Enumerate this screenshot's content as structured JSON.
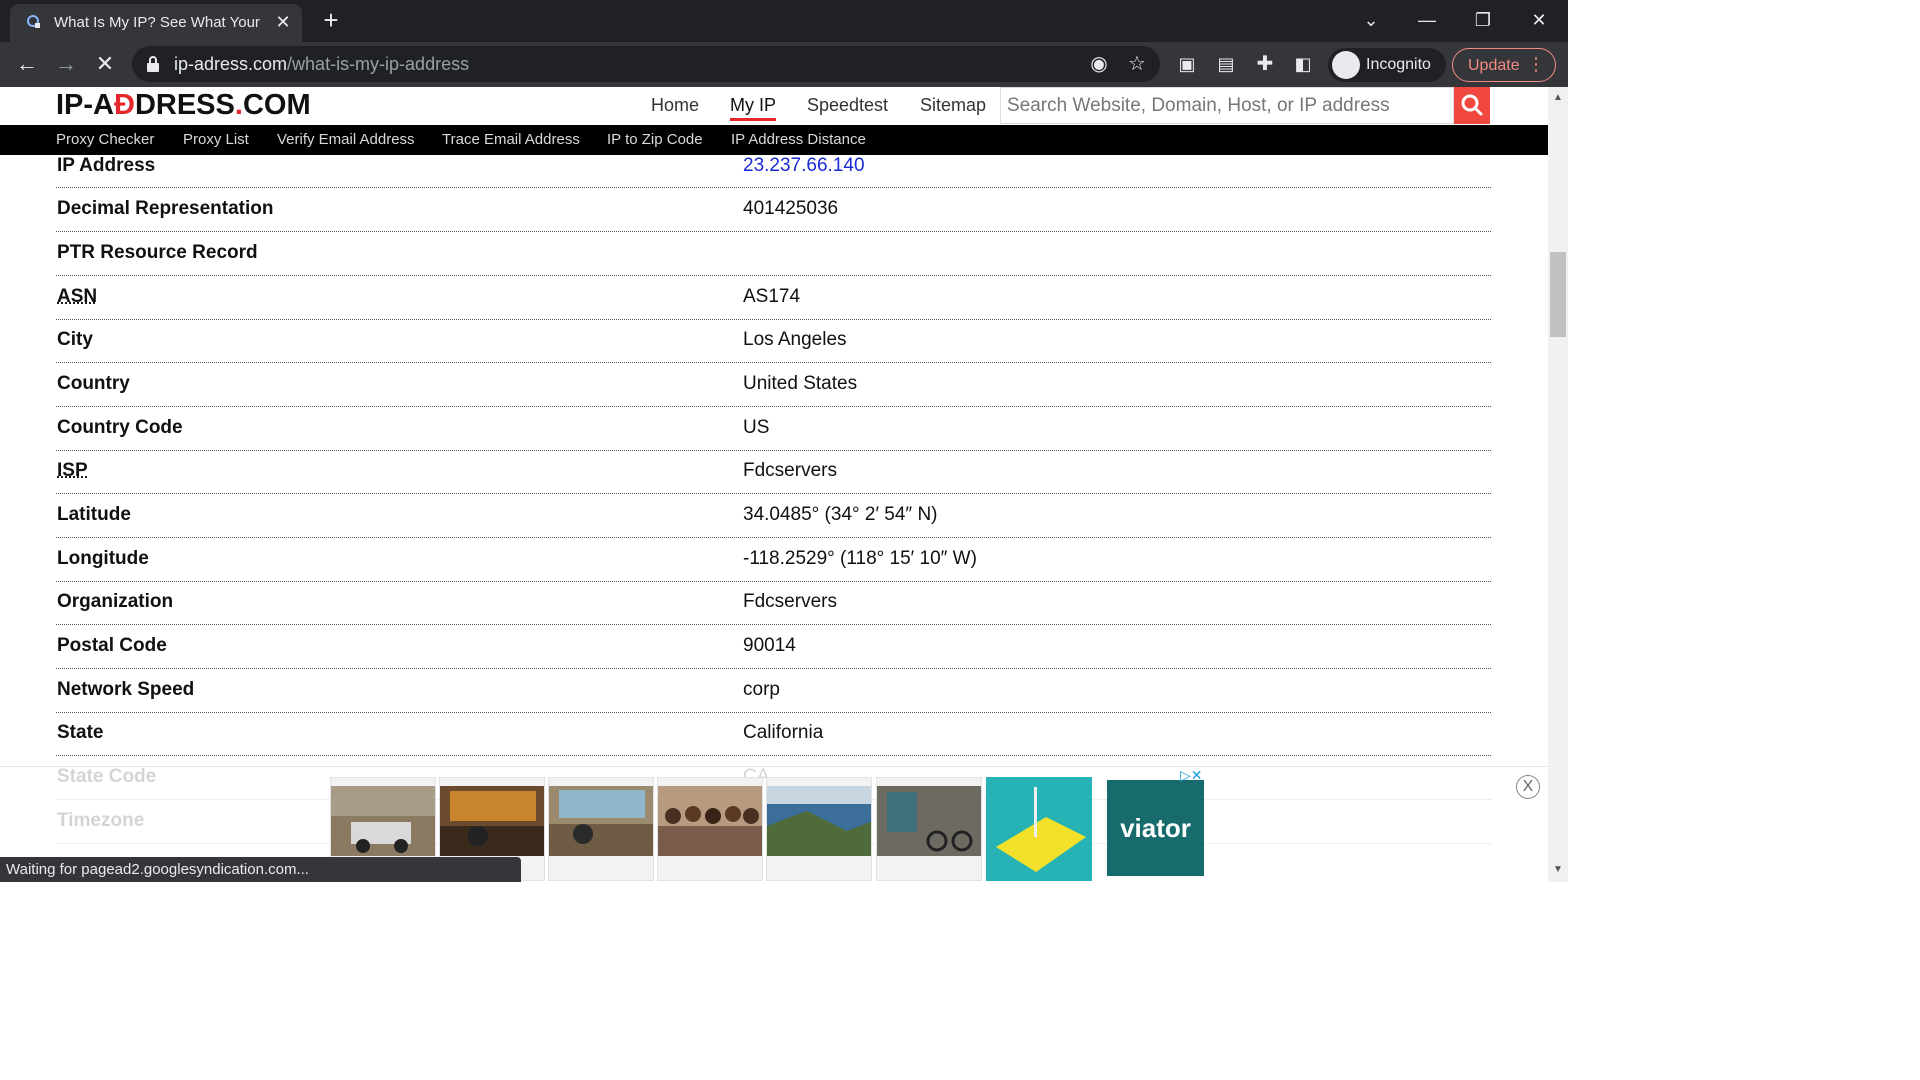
{
  "browser": {
    "tab_title": "What Is My IP? See What Your",
    "url_host": "ip-adress.com",
    "url_path": "/what-is-my-ip-address",
    "profile_label": "Incognito",
    "update_label": "Update",
    "status_text": "Waiting for pagead2.googlesyndication.com..."
  },
  "site": {
    "logo_part1": "IP-A",
    "logo_accent": "Đ",
    "logo_part2": "DRESS",
    "logo_dot": ".",
    "logo_part3": "COM",
    "nav": [
      "Home",
      "My IP",
      "Speedtest",
      "Sitemap"
    ],
    "active_nav": "My IP",
    "search_placeholder": "Search Website, Domain, Host, or IP address",
    "subnav": [
      "Proxy Checker",
      "Proxy List",
      "Verify Email Address",
      "Trace Email Address",
      "IP to Zip Code",
      "IP Address Distance"
    ]
  },
  "ip_details": [
    {
      "key": "IP Address",
      "value": "23.237.66.140"
    },
    {
      "key": "Decimal Representation",
      "value": "401425036"
    },
    {
      "key": "PTR Resource Record",
      "value": ""
    },
    {
      "key": "ASN",
      "value": "AS174"
    },
    {
      "key": "City",
      "value": "Los Angeles"
    },
    {
      "key": "Country",
      "value": "United States"
    },
    {
      "key": "Country Code",
      "value": "US"
    },
    {
      "key": "ISP",
      "value": "Fdcservers"
    },
    {
      "key": "Latitude",
      "value": "34.0485° (34° 2′ 54″ N)"
    },
    {
      "key": "Longitude",
      "value": "-118.2529° (118° 15′ 10″ W)"
    },
    {
      "key": "Organization",
      "value": "Fdcservers"
    },
    {
      "key": "Postal Code",
      "value": "90014"
    },
    {
      "key": "Network Speed",
      "value": "corp"
    },
    {
      "key": "State",
      "value": "California"
    },
    {
      "key": "State Code",
      "value": "CA"
    },
    {
      "key": "Timezone",
      "value": ""
    }
  ],
  "ad": {
    "brand": "viator",
    "choices_label": "▷✕",
    "close_label": "X"
  },
  "colors": {
    "accent_red": "#e5262b",
    "link_blue": "#1a2bd6",
    "chrome_dark": "#202124",
    "chrome_toolbar": "#35363a"
  }
}
